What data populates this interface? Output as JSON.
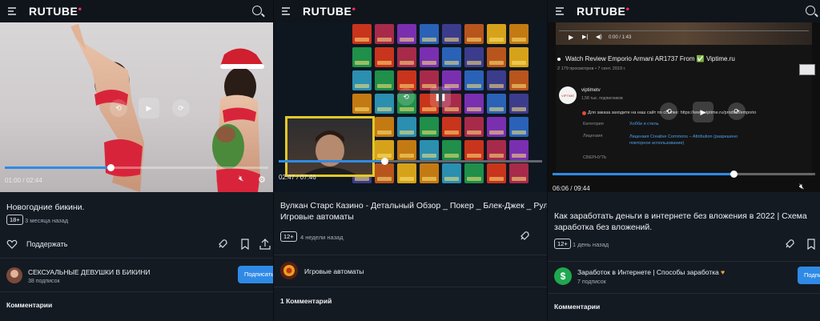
{
  "colors": {
    "accent": "#2f8ae6",
    "logo_accent": "#ff2e5f",
    "background": "#141a22"
  },
  "brand": "RUTUBE",
  "icons": [
    "menu-icon",
    "search-icon",
    "rocket-icon",
    "bookmark-icon",
    "share-icon",
    "play-icon",
    "rewind-icon",
    "forward-icon",
    "mute-icon",
    "settings-icon",
    "volume-icon",
    "pause-icon"
  ],
  "panel1": {
    "time": "01:00 / 02:44",
    "progress": 0.4,
    "title": "Новогодние бикини.",
    "age": "18+",
    "posted": "3 месяца назад",
    "support_label": "Поддержать",
    "channel": "СЕКСУАЛЬНЫЕ ДЕВУШКИ В БИКИНИ",
    "subs": "38 подписок",
    "subscribe": "Подписаться",
    "comments": "Комментарии"
  },
  "panel2": {
    "time": "02:47 / 07:46",
    "progress": 0.4,
    "title": "Вулкан Старс Казино - Детальный Обзор _ Покер _ Блек-Джек _ Рулетка _ Игровые автоматы",
    "age": "12+",
    "posted": "4 недели назад",
    "channel": "Игровые автоматы",
    "comments": "1 Комментарий"
  },
  "panel3": {
    "mini_time": "0:00 / 1:43",
    "embed_title": "Watch Review Emporio Armani AR1737 From ✅ Viptime.ru",
    "embed_meta": "2 179 просмотров • 7 сент. 2019 г.",
    "embed_channel": "viptimetv",
    "embed_subs": "1,58 тыс. подписчиков",
    "embed_order": "Для заказа заходите на наш сайт по ссылке: https://www.viptime.ru/product/emporio",
    "embed_cat_label": "Категория",
    "embed_cat_value": "Хобби и стиль",
    "embed_lic_label": "Лицензия",
    "embed_lic_value": "Лицензия Creative Commons – Attribution (разрешено повторное использование)",
    "embed_collapse": "СВЕРНУТЬ",
    "time": "06:06 / 09:44",
    "progress": 0.69,
    "title": "Как заработать деньги в интернете без вложения в 2022 | Схема заработка без вложений.",
    "age": "12+",
    "posted": "1 день назад",
    "channel": "Заработок в Интернете | Способы заработка",
    "subs": "7 подписок",
    "subscribe": "Подписаться",
    "comments": "Комментарии"
  }
}
